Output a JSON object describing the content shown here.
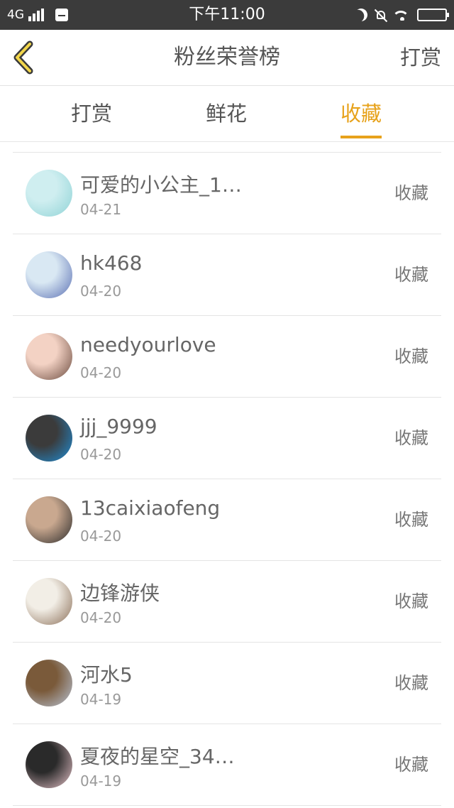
{
  "status_bar": {
    "network": "4G",
    "time": "下午11:00"
  },
  "header": {
    "title": "粉丝荣誉榜",
    "right_action": "打赏"
  },
  "tabs": [
    {
      "label": "打赏",
      "active": false
    },
    {
      "label": "鲜花",
      "active": false
    },
    {
      "label": "收藏",
      "active": true
    }
  ],
  "accent_color": "#e7a21b",
  "list": [
    {
      "name": "可爱的小公主_1…",
      "date": "04-21",
      "action": "收藏",
      "avatar_colors": [
        "#cfeef0",
        "#8fd3d6"
      ]
    },
    {
      "name": "hk468",
      "date": "04-20",
      "action": "收藏",
      "avatar_colors": [
        "#d9e8f3",
        "#5a6fb3"
      ]
    },
    {
      "name": "needyourlove",
      "date": "04-20",
      "action": "收藏",
      "avatar_colors": [
        "#f3d2c4",
        "#6a4a3e"
      ]
    },
    {
      "name": "jjj_9999",
      "date": "04-20",
      "action": "收藏",
      "avatar_colors": [
        "#3b3b3b",
        "#1f8fd8"
      ]
    },
    {
      "name": "13caixiaofeng",
      "date": "04-20",
      "action": "收藏",
      "avatar_colors": [
        "#c9a88f",
        "#2b2b2b"
      ]
    },
    {
      "name": "边锋游侠",
      "date": "04-20",
      "action": "收藏",
      "avatar_colors": [
        "#f2eee6",
        "#8a6e57"
      ]
    },
    {
      "name": "河水5",
      "date": "04-19",
      "action": "收藏",
      "avatar_colors": [
        "#7a5a3a",
        "#b8c4d6"
      ]
    },
    {
      "name": "夏夜的星空_34…",
      "date": "04-19",
      "action": "收藏",
      "avatar_colors": [
        "#2a2a2a",
        "#e6c2c8"
      ]
    }
  ]
}
